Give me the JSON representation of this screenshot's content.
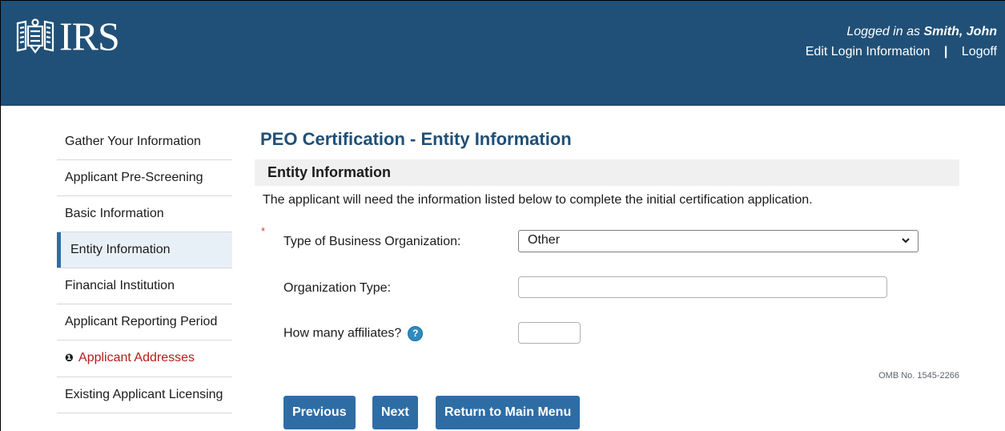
{
  "header": {
    "logo_text": "IRS",
    "logged_in_prefix": "Logged in as",
    "user_name": "Smith, John",
    "edit_login_link": "Edit Login Information",
    "separator": "|",
    "logoff_link": "Logoff",
    "background_color": "#205077"
  },
  "sidebar": {
    "items": [
      {
        "label": "Gather Your Information"
      },
      {
        "label": "Applicant Pre-Screening"
      },
      {
        "label": "Basic Information"
      },
      {
        "label": "Entity Information",
        "active": true
      },
      {
        "label": "Financial Institution"
      },
      {
        "label": "Applicant Reporting Period"
      },
      {
        "label": "Applicant Addresses",
        "warning": true,
        "icon": "exclamation-circle-icon",
        "icon_glyph": "❶"
      },
      {
        "label": "Existing Applicant Licensing"
      }
    ]
  },
  "main": {
    "page_title": "PEO Certification - Entity Information",
    "section_title": "Entity Information",
    "intro_text": "The applicant will need the information listed below to complete the initial certification application.",
    "required_marker": "*",
    "fields": {
      "business_org": {
        "label": "Type of Business Organization:",
        "value": "Other"
      },
      "org_type": {
        "label": "Organization Type:",
        "value": ""
      },
      "affiliates": {
        "label": "How many affiliates?",
        "value": "",
        "help_glyph": "?"
      }
    },
    "omb_number": "OMB No. 1545-2266",
    "buttons": {
      "previous": "Previous",
      "next": "Next",
      "return_main": "Return to Main Menu"
    }
  },
  "colors": {
    "accent": "#2e6da4",
    "title": "#205077",
    "warning": "#b51d1d",
    "required": "#d83933"
  }
}
